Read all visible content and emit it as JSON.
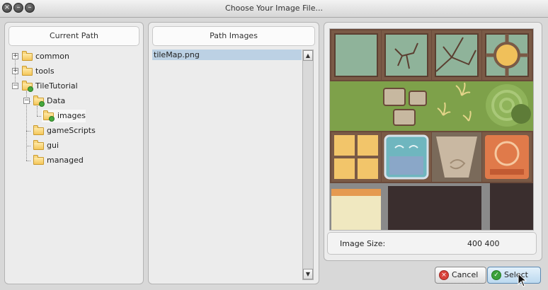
{
  "window": {
    "title": "Choose Your Image File...",
    "buttons": {
      "close": "close",
      "minimize": "minimize",
      "maximize": "maximize"
    }
  },
  "left_panel": {
    "header": "Current Path",
    "tree": [
      {
        "label": "common"
      },
      {
        "label": "tools"
      },
      {
        "label": "TileTutorial"
      },
      {
        "label": "Data"
      },
      {
        "label": "images"
      },
      {
        "label": "gameScripts"
      },
      {
        "label": "gui"
      },
      {
        "label": "managed"
      }
    ]
  },
  "middle_panel": {
    "header": "Path Images",
    "files": [
      {
        "label": "tileMap.png",
        "selected": true
      }
    ]
  },
  "preview": {
    "info_label": "Image Size:",
    "info_value": "400 400"
  },
  "actions": {
    "cancel_label": "Cancel",
    "select_label": "Select"
  },
  "colors": {
    "selection": "#bcd1e4",
    "cancel_icon": "#d9423a",
    "select_icon": "#3aa13a",
    "select_button": "#cfe6f7"
  }
}
